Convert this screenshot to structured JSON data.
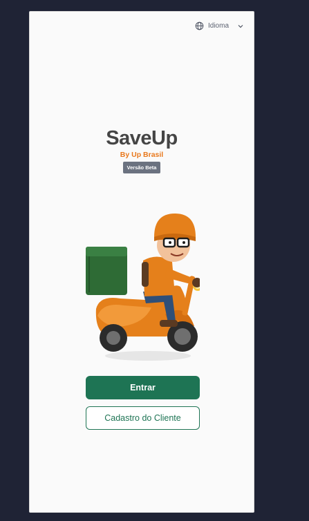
{
  "header": {
    "language_label": "Idioma",
    "language_icon": "globe-icon",
    "dropdown_icon": "chevron-down-icon"
  },
  "brand": {
    "title": "SaveUp",
    "subtitle": "By Up Brasil",
    "badge": "Versão Beta"
  },
  "illustration": {
    "name": "delivery-scooter-rider"
  },
  "actions": {
    "login_label": "Entrar",
    "register_label": "Cadastro do Cliente"
  },
  "colors": {
    "primary": "#1e7454",
    "accent": "#e8781c",
    "background": "#1f2335"
  }
}
